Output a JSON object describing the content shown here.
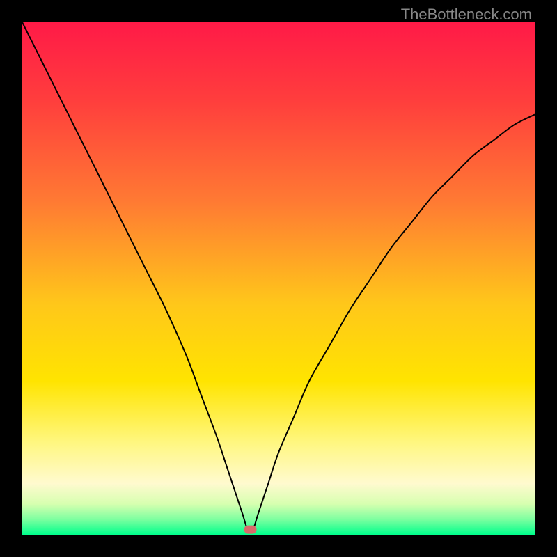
{
  "watermark": "TheBottleneck.com",
  "chart_data": {
    "type": "line",
    "title": "",
    "xlabel": "",
    "ylabel": "",
    "xlim": [
      0,
      100
    ],
    "ylim": [
      0,
      100
    ],
    "grid": false,
    "legend": false,
    "background_gradient": {
      "type": "vertical",
      "stops": [
        {
          "offset": 0.0,
          "color": "#ff1a47"
        },
        {
          "offset": 0.15,
          "color": "#ff3d3d"
        },
        {
          "offset": 0.35,
          "color": "#ff7a33"
        },
        {
          "offset": 0.55,
          "color": "#ffc71a"
        },
        {
          "offset": 0.7,
          "color": "#ffe400"
        },
        {
          "offset": 0.82,
          "color": "#fff780"
        },
        {
          "offset": 0.9,
          "color": "#fffacf"
        },
        {
          "offset": 0.94,
          "color": "#d7ffb0"
        },
        {
          "offset": 0.97,
          "color": "#7dffa0"
        },
        {
          "offset": 1.0,
          "color": "#00ff8c"
        }
      ]
    },
    "marker": {
      "x": 44.5,
      "y": 1.0,
      "color": "#d86a6a",
      "shape": "rounded-rect"
    },
    "series": [
      {
        "name": "curve",
        "color": "#000000",
        "width": 2,
        "x": [
          0,
          4,
          8,
          12,
          16,
          20,
          24,
          28,
          32,
          35,
          38,
          40,
          42,
          43,
          44,
          45,
          46,
          48,
          50,
          53,
          56,
          60,
          64,
          68,
          72,
          76,
          80,
          84,
          88,
          92,
          96,
          100
        ],
        "y": [
          100,
          92,
          84,
          76,
          68,
          60,
          52,
          44,
          35,
          27,
          19,
          13,
          7,
          4,
          1,
          1,
          4,
          10,
          16,
          23,
          30,
          37,
          44,
          50,
          56,
          61,
          66,
          70,
          74,
          77,
          80,
          82
        ]
      }
    ]
  }
}
